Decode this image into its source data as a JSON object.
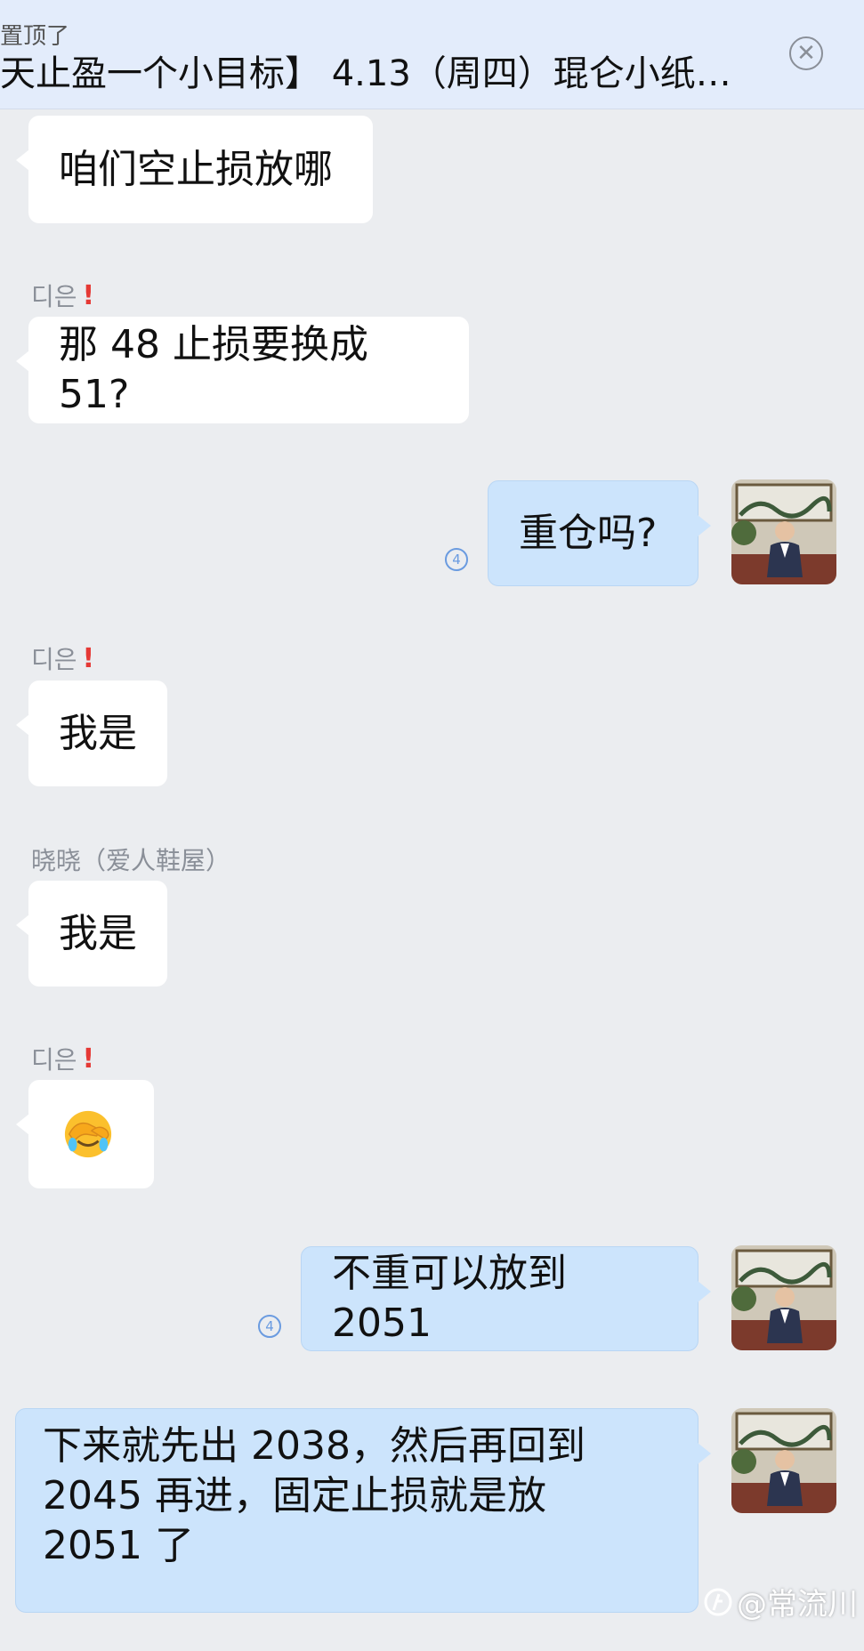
{
  "pinned": {
    "tag": "置顶了",
    "title": "天止盈一个小目标】 4.13（周四）琨仑小纸…"
  },
  "senders": {
    "s1": "디은",
    "s2": "晓晓（爱人鞋屋）"
  },
  "messages": {
    "m1": "咱们空止损放哪",
    "m2": "那 48 止损要换成 51?",
    "m3": "重仓吗?",
    "m4": "我是",
    "m5": "我是",
    "m7": "不重可以放到 2051",
    "m8": "下来就先出 2038，然后再回到 2045 再进，固定止损就是放 2051 了"
  },
  "read_counts": {
    "r1": "4",
    "r2": "4"
  },
  "watermark": "@常流川",
  "colors": {
    "out_bubble": "#cce4fc",
    "in_bubble": "#ffffff",
    "background": "#ebedf0",
    "alert": "#e53935"
  }
}
